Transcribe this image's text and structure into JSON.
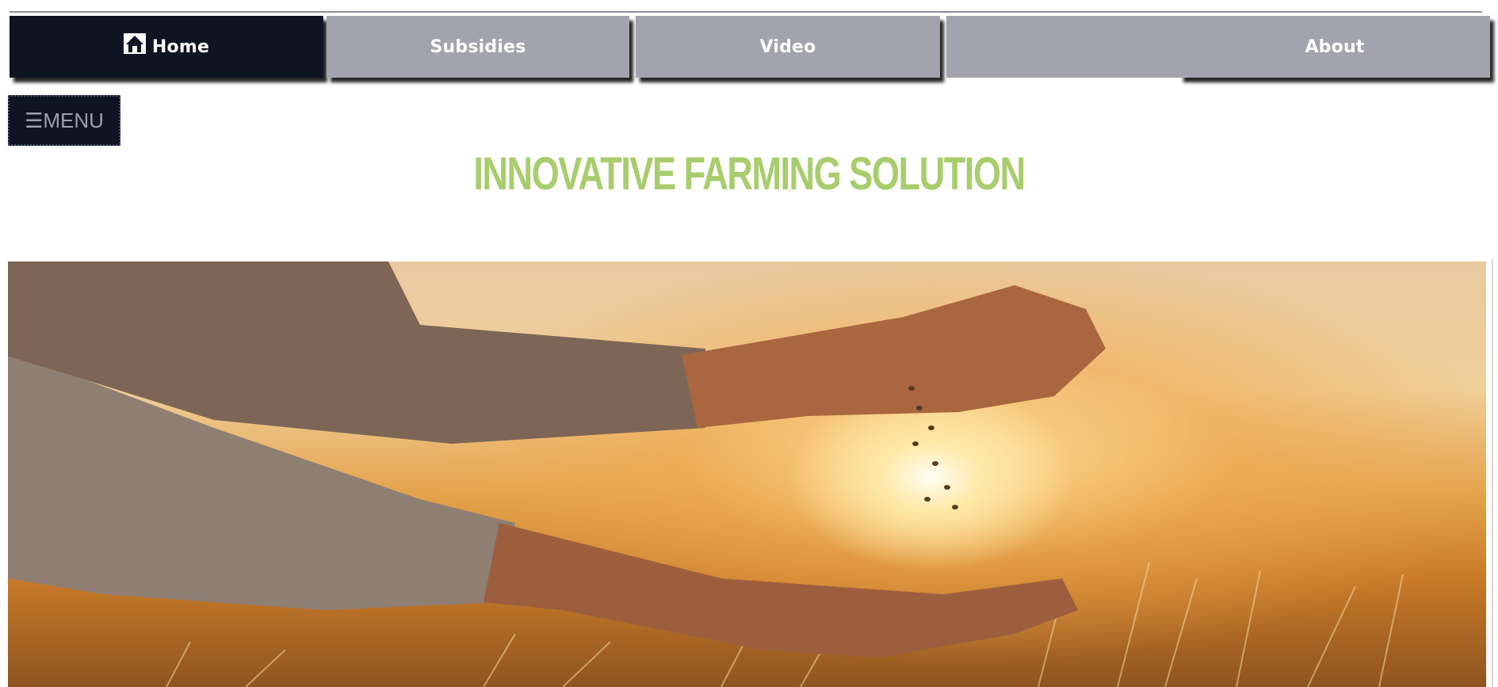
{
  "nav": {
    "items": [
      {
        "label": "Home",
        "icon": "home-icon",
        "active": true
      },
      {
        "label": "Subsidies"
      },
      {
        "label": "Video"
      },
      {
        "label": ""
      },
      {
        "label": "About"
      }
    ]
  },
  "menu_button": {
    "icon": "hamburger-icon",
    "label": "☰MENU"
  },
  "page_title": "Innovative Farming Solution",
  "colors": {
    "nav_active": "#0f1423",
    "nav_inactive": "#a2a3ad",
    "title": "#a8cd6c"
  }
}
